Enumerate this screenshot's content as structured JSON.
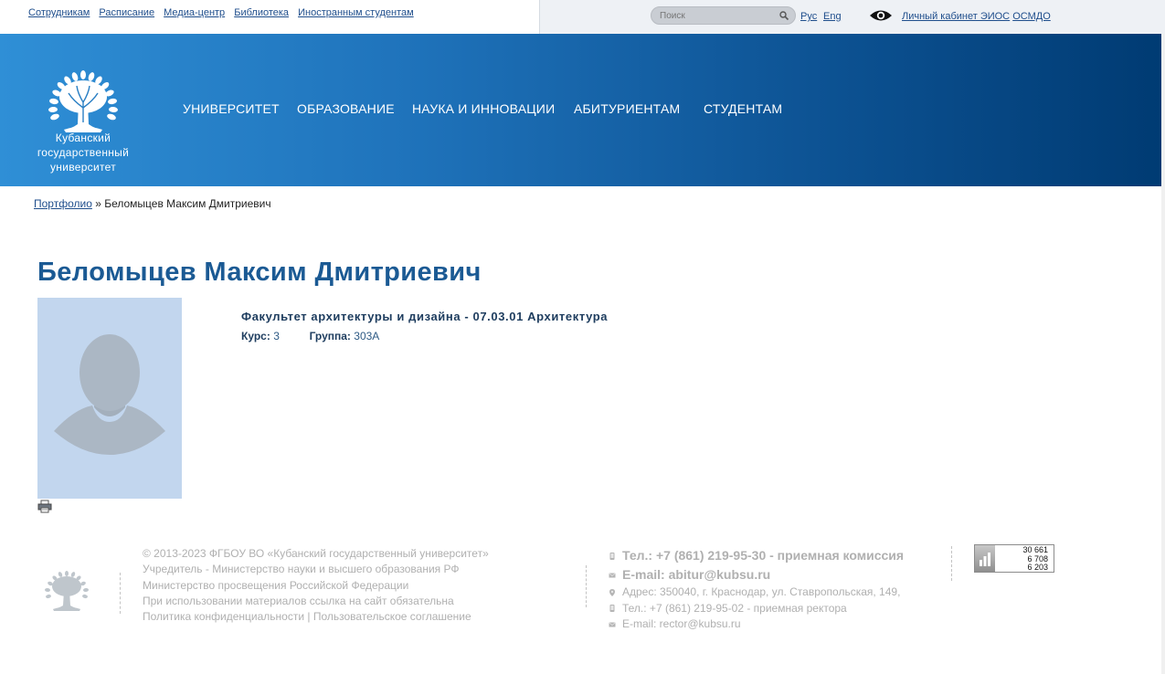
{
  "topbar": {
    "links": [
      "Сотрудникам",
      "Расписание",
      "Медиа-центр",
      "Библиотека",
      "Иностранным студентам"
    ],
    "search_placeholder": "Поиск",
    "lang_ru": "Рус",
    "lang_en": "Eng",
    "cabinet": "Личный кабинет ЭИОС",
    "osmdo": "ОСМДО"
  },
  "header": {
    "logo_line1": "Кубанский",
    "logo_line2": "государственный",
    "logo_line3": "университет",
    "nav": [
      "УНИВЕРСИТЕТ",
      "ОБРАЗОВАНИЕ",
      "НАУКА И ИННОВАЦИИ",
      "АБИТУРИЕНТАМ",
      "СТУДЕНТАМ"
    ]
  },
  "breadcrumb": {
    "root": "Портфолио",
    "sep": " » ",
    "current": "Беломыцев Максим Дмитриевич"
  },
  "profile": {
    "name": "Беломыцев Максим Дмитриевич",
    "faculty": "Факультет архитектуры и дизайна - 07.03.01 Архитектура",
    "course_label": "Курс:",
    "course_value": "3",
    "group_label": "Группа:",
    "group_value": "303А"
  },
  "footer": {
    "left": [
      "© 2013-2023 ФГБОУ ВО «Кубанский государственный университет»",
      "Учредитель - Министерство науки и высшего образования РФ",
      "Министерство просвещения Российской Федерации",
      "При использовании материалов ссылка на сайт обязательна"
    ],
    "privacy": "Политика конфиденциальности",
    "pipe": " | ",
    "agreement": "Пользовательское соглашение",
    "phone_main": "Тел.: +7 (861) 219-95-30 - приемная комиссия",
    "email_main": "E-mail: abitur@kubsu.ru",
    "address": "Адрес: 350040, г. Краснодар, ул. Ставропольская, 149,",
    "phone_rector": "Тел.: +7 (861) 219-95-02 - приемная ректора",
    "email_rector": "E-mail: rector@kubsu.ru",
    "counter": [
      "30 661",
      "6 708",
      "6 203"
    ]
  }
}
